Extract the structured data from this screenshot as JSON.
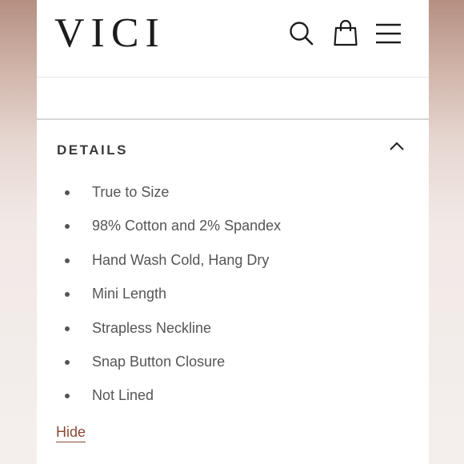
{
  "header": {
    "logo": "VICI",
    "icons": [
      "search-icon",
      "shopping-bag-icon",
      "menu-icon"
    ]
  },
  "details": {
    "title": "DETAILS",
    "items": [
      "True to Size",
      "98% Cotton and 2% Spandex",
      "Hand Wash Cold, Hang Dry",
      "Mini Length",
      "Strapless Neckline",
      "Snap Button Closure",
      "Not Lined"
    ],
    "hide_label": "Hide"
  },
  "colors": {
    "link": "#8a4a34",
    "text": "#555555",
    "title": "#3a3a3a"
  }
}
